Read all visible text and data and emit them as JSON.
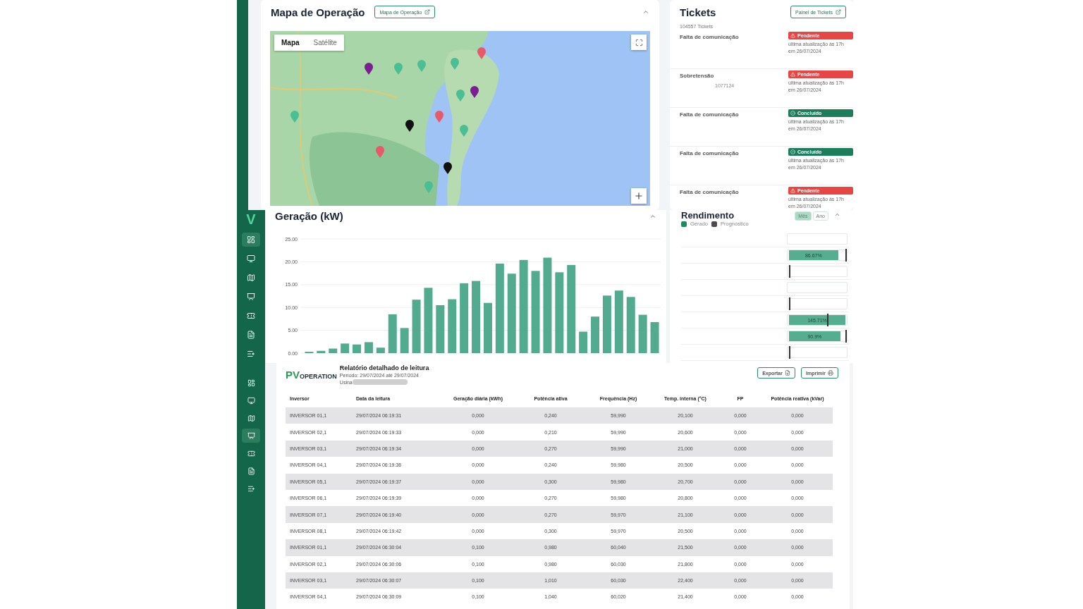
{
  "map_card": {
    "title": "Mapa de Operação",
    "link_button": "Mapa de Operação",
    "map_types": [
      {
        "label": "Mapa",
        "selected": true
      },
      {
        "label": "Satélite",
        "selected": false
      }
    ]
  },
  "tickets": {
    "title": "Tickets",
    "link_button": "Painel de Tickets",
    "count": "104557 Tickets",
    "items": [
      {
        "title": "Falta de comunicação",
        "kind": "pending",
        "badge": "Pendente",
        "updated": "última atualização às 17h",
        "date": "em 26/07/2024"
      },
      {
        "title": "Sobretensão",
        "code": "1077124",
        "kind": "pending",
        "badge": "Pendente",
        "updated": "última atualização às 17h",
        "date": "em 26/07/2024"
      },
      {
        "title": "Falta de comunicação",
        "kind": "done",
        "badge": "Concluído",
        "updated": "última atualização às 17h",
        "date": "em 26/07/2024"
      },
      {
        "title": "Falta de comunicação",
        "kind": "done",
        "badge": "Concluído",
        "updated": "última atualização às 17h",
        "date": "em 26/07/2024"
      },
      {
        "title": "Falta de comunicação",
        "kind": "pending",
        "badge": "Pendente",
        "updated": "última atualização às 17h",
        "date": "em 26/07/2024"
      }
    ]
  },
  "sidebar": {
    "logo": "V",
    "items": [
      {
        "kind": "dashboard",
        "selected": true
      },
      {
        "kind": "monitor",
        "selected": false
      },
      {
        "kind": "map",
        "selected": false
      },
      {
        "kind": "report",
        "selected": false
      },
      {
        "kind": "tickets",
        "selected": false
      },
      {
        "kind": "file",
        "selected": false
      },
      {
        "kind": "add-list",
        "selected": false
      }
    ]
  },
  "report_sidebar": {
    "items": [
      {
        "kind": "dashboard",
        "selected": false
      },
      {
        "kind": "monitor",
        "selected": false
      },
      {
        "kind": "map",
        "selected": false
      },
      {
        "kind": "report",
        "selected": true
      },
      {
        "kind": "tickets",
        "selected": false
      },
      {
        "kind": "file",
        "selected": false
      },
      {
        "kind": "add-list",
        "selected": false
      }
    ]
  },
  "generation": {
    "title": "Geração (kW)",
    "chart_data": {
      "type": "bar",
      "grid": true,
      "ylim": [
        0,
        25
      ],
      "yticks": [
        {
          "value": 0,
          "label": "0.00"
        },
        {
          "value": 5,
          "label": "5.00"
        },
        {
          "value": 10,
          "label": "10.00"
        },
        {
          "value": 15,
          "label": "15.00"
        },
        {
          "value": 20,
          "label": "20.00"
        },
        {
          "value": 25,
          "label": "25.00"
        }
      ],
      "series": [
        {
          "color": "#52ab8f",
          "values": [
            0.3,
            0.5,
            1.0,
            2.1,
            1.9,
            2.4,
            1.2,
            8.5,
            5.5,
            11.7,
            14.3,
            10.5,
            11.8,
            15.3,
            15.8,
            11.0,
            19.6,
            17.4,
            20.4,
            18.0,
            20.9,
            17.7,
            19.3,
            4.7,
            8.0,
            12.6,
            13.7,
            12.3,
            8.4,
            6.8
          ]
        }
      ]
    }
  },
  "yield": {
    "title": "Rendimento",
    "periods": [
      {
        "label": "Mês",
        "selected": true
      },
      {
        "label": "Ano",
        "selected": false
      }
    ],
    "legend": [
      {
        "label": "Gerado",
        "color": "#178a5e"
      },
      {
        "label": "Prognóstico",
        "color": "#4a4a4f"
      }
    ],
    "rows": [
      {
        "kind": "plain"
      },
      {
        "level": 0.87,
        "reading": "86.67%",
        "kind": "marker-end"
      },
      {
        "kind": "marker-start"
      },
      {
        "kind": "plain"
      },
      {
        "kind": "marker-start"
      },
      {
        "level": 1,
        "reading": "145.71%",
        "kind": "marker-inside"
      },
      {
        "level": 0.91,
        "reading": "90.9%",
        "kind": "marker-end"
      },
      {
        "kind": "marker-start"
      }
    ]
  },
  "report": {
    "logo_main": "PV",
    "logo_word": "OPERATION",
    "title": "Relatório detalhado de leitura",
    "period": "Período: 29/07/2024 até 29/07/2024",
    "plant_label": "Usina",
    "buttons": [
      "Exportar",
      "Imprimir"
    ],
    "columns": [
      "Inversor",
      "Data da leitura",
      "Geração diária (kWh)",
      "Potência ativa",
      "Frequência (Hz)",
      "Temp. interna (°C)",
      "FP",
      "Potência reativa (kVar)"
    ],
    "rows": [
      [
        "INVERSOR 01,1",
        "29/07/2024 06:19:31",
        "0,000",
        "0,240",
        "59,990",
        "20,100",
        "0,000",
        "0,000"
      ],
      [
        "INVERSOR 02,1",
        "29/07/2024 06:19:33",
        "0,000",
        "0,210",
        "59,990",
        "20,600",
        "0,000",
        "0,000"
      ],
      [
        "INVERSOR 03,1",
        "29/07/2024 06:19:34",
        "0,000",
        "0,270",
        "59,990",
        "21,000",
        "0,000",
        "0,000"
      ],
      [
        "INVERSOR 04,1",
        "29/07/2024 06:19:36",
        "0,000",
        "0,240",
        "59,980",
        "20,500",
        "0,000",
        "0,000"
      ],
      [
        "INVERSOR 05,1",
        "29/07/2024 06:19:37",
        "0,000",
        "0,300",
        "59,980",
        "20,700",
        "0,000",
        "0,000"
      ],
      [
        "INVERSOR 06,1",
        "29/07/2024 06:19:39",
        "0,000",
        "0,270",
        "59,980",
        "20,800",
        "0,000",
        "0,000"
      ],
      [
        "INVERSOR 07,1",
        "29/07/2024 06:19:40",
        "0,000",
        "0,270",
        "59,970",
        "21,100",
        "0,000",
        "0,000"
      ],
      [
        "INVERSOR 08,1",
        "29/07/2024 06:19:42",
        "0,000",
        "0,300",
        "59,970",
        "20,500",
        "0,000",
        "0,000"
      ],
      [
        "INVERSOR 01,1",
        "29/07/2024 06:30:04",
        "0,100",
        "0,980",
        "60,040",
        "21,500",
        "0,000",
        "0,000"
      ],
      [
        "INVERSOR 02,1",
        "29/07/2024 06:30:06",
        "0,100",
        "0,980",
        "60,030",
        "21,800",
        "0,000",
        "0,000"
      ],
      [
        "INVERSOR 03,1",
        "29/07/2024 06:30:07",
        "0,100",
        "1,010",
        "60,030",
        "22,400",
        "0,000",
        "0,000"
      ],
      [
        "INVERSOR 04,1",
        "29/07/2024 06:30:09",
        "0,100",
        "1,040",
        "60,020",
        "21,400",
        "0,000",
        "0,000"
      ]
    ]
  }
}
